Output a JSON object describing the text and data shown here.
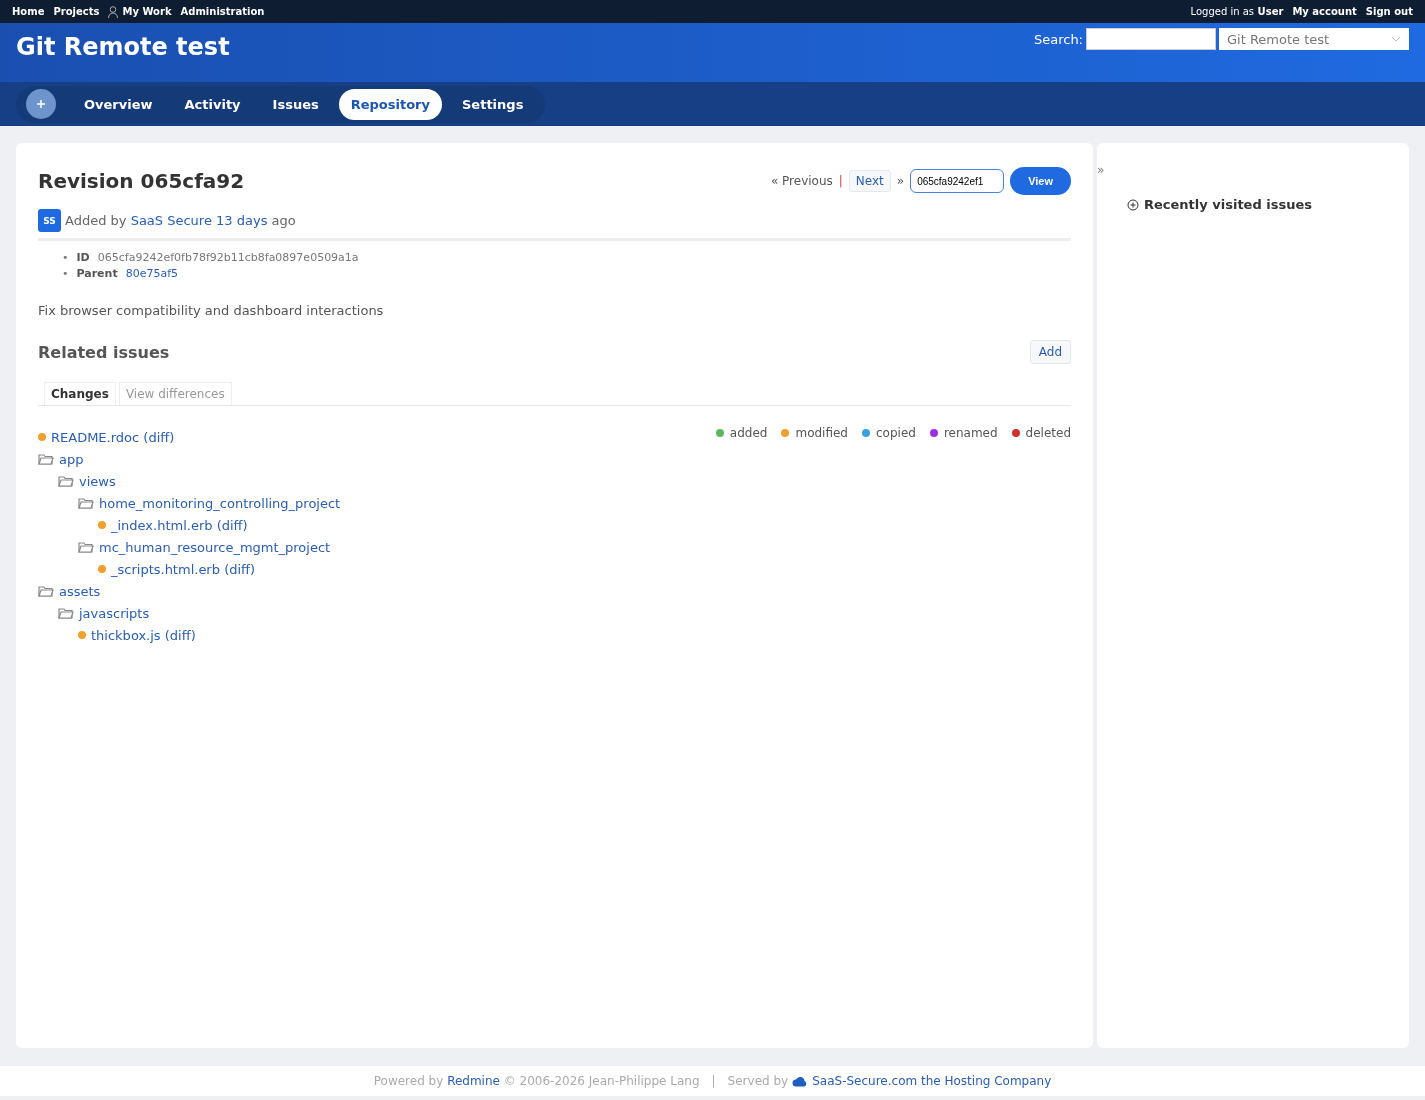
{
  "top_menu": {
    "items": [
      {
        "label": "Home",
        "kind": "link"
      },
      {
        "label": "Projects",
        "kind": "link"
      },
      {
        "label": "My Work",
        "kind": "user"
      },
      {
        "label": "Administration",
        "kind": "link"
      }
    ],
    "account": {
      "prefix": "Logged in as",
      "user": "User",
      "links": [
        "My account",
        "Sign out"
      ]
    }
  },
  "header": {
    "title": "Git Remote test",
    "search_label": "Search:",
    "project_select": "Git Remote test"
  },
  "main_menu": {
    "tabs": [
      {
        "label": "Overview",
        "selected": false
      },
      {
        "label": "Activity",
        "selected": false
      },
      {
        "label": "Issues",
        "selected": false
      },
      {
        "label": "Repository",
        "selected": true
      },
      {
        "label": "Settings",
        "selected": false
      }
    ]
  },
  "revision": {
    "title": "Revision 065cfa92",
    "previous": "« Previous",
    "separator": "|",
    "next": "Next",
    "next_arrow": "»",
    "rev_value": "065cfa9242ef1",
    "view_button": "View",
    "author": {
      "avatar": "SS",
      "added_by": "Added by",
      "name": "SaaS Secure",
      "age": "13 days",
      "ago": "ago"
    },
    "details": [
      {
        "bullet": "•",
        "label": "ID",
        "value": "065cfa9242ef0fb78f92b11cb8fa0897e0509a1a",
        "link": false
      },
      {
        "bullet": "•",
        "label": "Parent",
        "value": "80e75af5",
        "link": true
      }
    ],
    "message": "Fix browser compatibility and dashboard interactions",
    "related_title": "Related issues",
    "add_button": "Add",
    "tabs": [
      {
        "label": "Changes",
        "selected": true
      },
      {
        "label": "View differences",
        "selected": false
      }
    ],
    "legend": [
      {
        "label": "added",
        "color": "#5cb85c"
      },
      {
        "label": "modified",
        "color": "#f0a030"
      },
      {
        "label": "copied",
        "color": "#3aa0e0"
      },
      {
        "label": "renamed",
        "color": "#9b30e0"
      },
      {
        "label": "deleted",
        "color": "#d03030"
      }
    ],
    "tree": [
      {
        "kind": "file",
        "name": "README.rdoc",
        "diff": "(diff)",
        "color": "#f0a030"
      },
      {
        "kind": "folder",
        "name": "app",
        "children": [
          {
            "kind": "folder",
            "name": "views",
            "children": [
              {
                "kind": "folder",
                "name": "home_monitoring_controlling_project",
                "children": [
                  {
                    "kind": "file",
                    "name": "_index.html.erb",
                    "diff": "(diff)",
                    "color": "#f0a030"
                  }
                ]
              },
              {
                "kind": "folder",
                "name": "mc_human_resource_mgmt_project",
                "children": [
                  {
                    "kind": "file",
                    "name": "_scripts.html.erb",
                    "diff": "(diff)",
                    "color": "#f0a030"
                  }
                ]
              }
            ]
          }
        ]
      },
      {
        "kind": "folder",
        "name": "assets",
        "children": [
          {
            "kind": "folder",
            "name": "javascripts",
            "children": [
              {
                "kind": "file",
                "name": "thickbox.js",
                "diff": "(diff)",
                "color": "#f0a030"
              }
            ]
          }
        ]
      }
    ]
  },
  "sidebar": {
    "toggle": "»",
    "title": "Recently visited issues"
  },
  "footer": {
    "powered_by": "Powered by",
    "redmine": "Redmine",
    "copyright": "© 2006-2026 Jean-Philippe Lang",
    "separator": "|",
    "served_by": "Served by",
    "host": "SaaS-Secure.com the Hosting Company"
  }
}
